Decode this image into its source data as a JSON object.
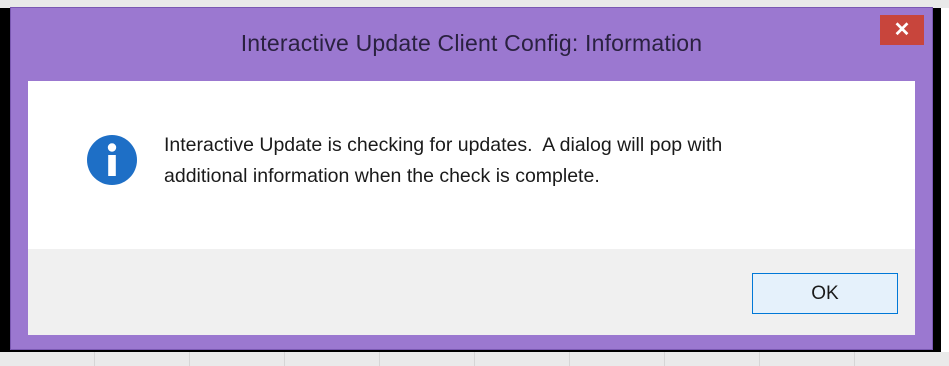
{
  "window": {
    "title": "Interactive Update Client Config: Information",
    "close_glyph": "✕",
    "accent_color": "#9b78d0",
    "close_color": "#c8453c"
  },
  "message": {
    "icon": "info-icon",
    "line1": "Interactive Update is checking for updates.  A dialog will pop with",
    "line2": "additional information when the check is complete."
  },
  "buttons": {
    "ok_label": "OK"
  }
}
